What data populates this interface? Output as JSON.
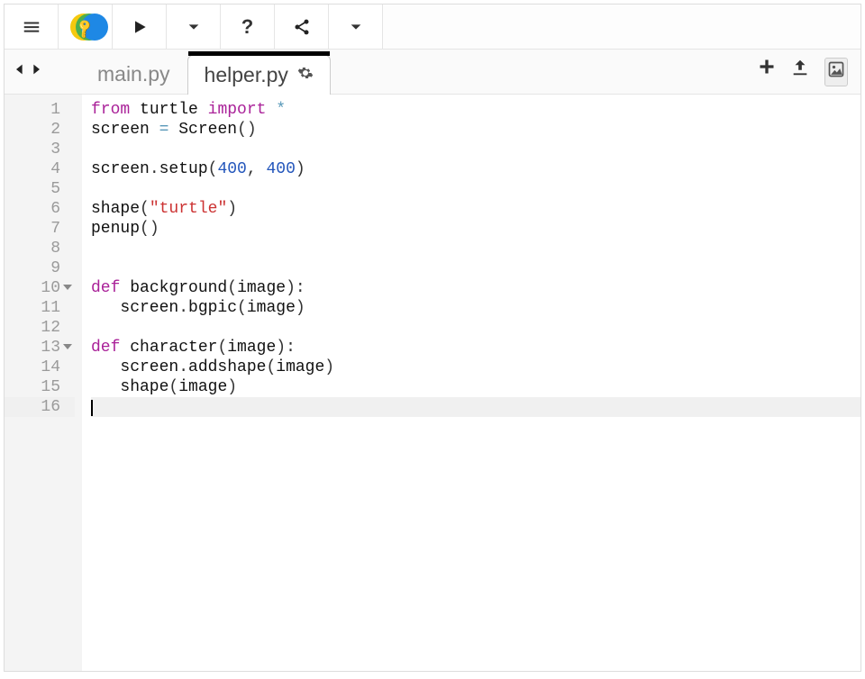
{
  "toolbar": {
    "menu_icon": "menu-icon",
    "play_icon": "play-icon",
    "dropdown1_icon": "chevron-down-icon",
    "help_label": "?",
    "share_icon": "share-icon",
    "dropdown2_icon": "chevron-down-icon"
  },
  "nav": {
    "back": "‹",
    "forward": "›"
  },
  "tabs": [
    {
      "label": "main.py",
      "active": false
    },
    {
      "label": "helper.py",
      "active": true
    }
  ],
  "tab_actions": {
    "gear_icon": "gear-icon",
    "add_icon": "plus-icon",
    "upload_icon": "upload-icon",
    "image_icon": "image-icon"
  },
  "editor": {
    "lines": [
      {
        "n": 1,
        "fold": false,
        "tokens": [
          [
            "kw",
            "from"
          ],
          [
            "pn",
            " "
          ],
          [
            "fn",
            "turtle"
          ],
          [
            "pn",
            " "
          ],
          [
            "kw",
            "import"
          ],
          [
            "pn",
            " "
          ],
          [
            "op",
            "*"
          ]
        ]
      },
      {
        "n": 2,
        "fold": false,
        "tokens": [
          [
            "fn",
            "screen "
          ],
          [
            "op",
            "="
          ],
          [
            "fn",
            " Screen"
          ],
          [
            "pn",
            "()"
          ]
        ]
      },
      {
        "n": 3,
        "fold": false,
        "tokens": []
      },
      {
        "n": 4,
        "fold": false,
        "tokens": [
          [
            "fn",
            "screen"
          ],
          [
            "pn",
            "."
          ],
          [
            "fn",
            "setup"
          ],
          [
            "pn",
            "("
          ],
          [
            "num",
            "400"
          ],
          [
            "pn",
            ", "
          ],
          [
            "num",
            "400"
          ],
          [
            "pn",
            ")"
          ]
        ]
      },
      {
        "n": 5,
        "fold": false,
        "tokens": []
      },
      {
        "n": 6,
        "fold": false,
        "tokens": [
          [
            "fn",
            "shape"
          ],
          [
            "pn",
            "("
          ],
          [
            "str",
            "\"turtle\""
          ],
          [
            "pn",
            ")"
          ]
        ]
      },
      {
        "n": 7,
        "fold": false,
        "tokens": [
          [
            "fn",
            "penup"
          ],
          [
            "pn",
            "()"
          ]
        ]
      },
      {
        "n": 8,
        "fold": false,
        "tokens": []
      },
      {
        "n": 9,
        "fold": false,
        "tokens": []
      },
      {
        "n": 10,
        "fold": true,
        "tokens": [
          [
            "kw",
            "def"
          ],
          [
            "pn",
            " "
          ],
          [
            "fn",
            "background"
          ],
          [
            "pn",
            "("
          ],
          [
            "fn",
            "image"
          ],
          [
            "pn",
            "):"
          ]
        ]
      },
      {
        "n": 11,
        "fold": false,
        "tokens": [
          [
            "pn",
            "   "
          ],
          [
            "fn",
            "screen"
          ],
          [
            "pn",
            "."
          ],
          [
            "fn",
            "bgpic"
          ],
          [
            "pn",
            "("
          ],
          [
            "fn",
            "image"
          ],
          [
            "pn",
            ")"
          ]
        ]
      },
      {
        "n": 12,
        "fold": false,
        "tokens": []
      },
      {
        "n": 13,
        "fold": true,
        "tokens": [
          [
            "kw",
            "def"
          ],
          [
            "pn",
            " "
          ],
          [
            "fn",
            "character"
          ],
          [
            "pn",
            "("
          ],
          [
            "fn",
            "image"
          ],
          [
            "pn",
            "):"
          ]
        ]
      },
      {
        "n": 14,
        "fold": false,
        "tokens": [
          [
            "pn",
            "   "
          ],
          [
            "fn",
            "screen"
          ],
          [
            "pn",
            "."
          ],
          [
            "fn",
            "addshape"
          ],
          [
            "pn",
            "("
          ],
          [
            "fn",
            "image"
          ],
          [
            "pn",
            ")"
          ]
        ]
      },
      {
        "n": 15,
        "fold": false,
        "tokens": [
          [
            "pn",
            "   "
          ],
          [
            "fn",
            "shape"
          ],
          [
            "pn",
            "("
          ],
          [
            "fn",
            "image"
          ],
          [
            "pn",
            ")"
          ]
        ]
      },
      {
        "n": 16,
        "fold": false,
        "tokens": [],
        "active": true,
        "cursor": true
      }
    ]
  }
}
